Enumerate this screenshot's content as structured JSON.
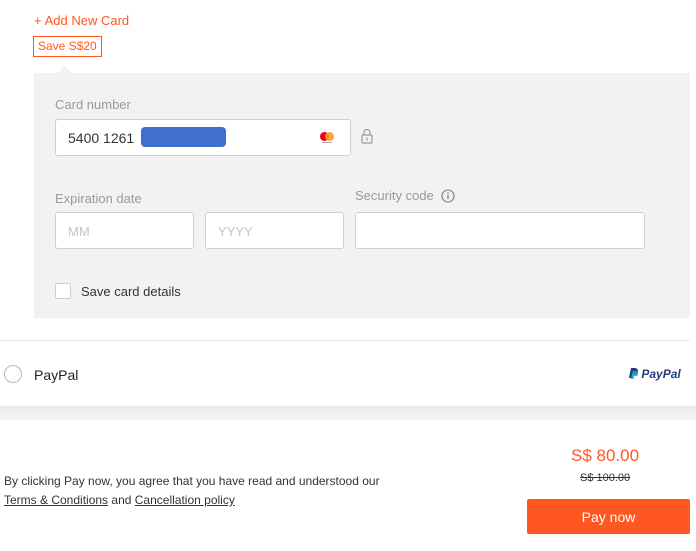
{
  "add_card": {
    "plus": "+",
    "label": "Add New Card"
  },
  "promo": {
    "badge": "Save S$20"
  },
  "card_form": {
    "card_number_label": "Card number",
    "card_number_value": "5400 1261",
    "card_brand_icon": "mastercard-icon",
    "expiration_label": "Expiration date",
    "month_placeholder": "MM",
    "year_placeholder": "YYYY",
    "security_label": "Security code",
    "save_card_label": "Save card details",
    "save_card_checked": false
  },
  "payment_methods": [
    {
      "label": "PayPal",
      "selected": false,
      "logo_part1": "PayPal",
      "logo_part2": ""
    }
  ],
  "summary": {
    "agreement_text": "By clicking Pay now, you agree that you have read and understood our",
    "terms_link": "Terms & Conditions",
    "and_text": "and",
    "cancellation_link": "Cancellation policy",
    "price": "S$ 80.00",
    "original_price": "S$ 100.00",
    "pay_button": "Pay now"
  },
  "colors": {
    "accent": "#ff5722",
    "panel": "#f2f2f2",
    "redaction": "#3f6fcf"
  }
}
